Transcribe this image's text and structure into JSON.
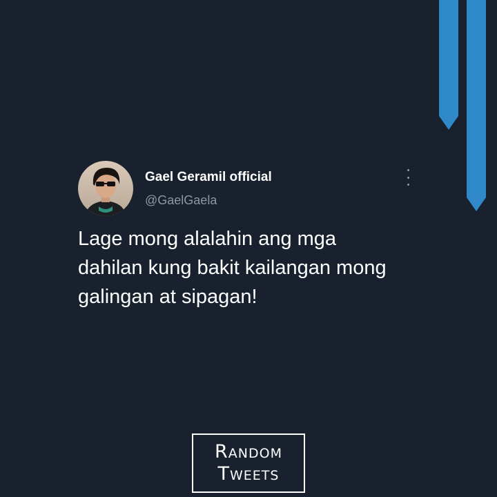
{
  "tweet": {
    "display_name": "Gael Geramil official",
    "handle": "@GaelGaela",
    "text": "Lage mong alalahin ang mga dahilan kung bakit kailangan mong galingan at sipagan!"
  },
  "logo": {
    "line1": "Random",
    "line2": "Tweets"
  },
  "colors": {
    "background": "#18212d",
    "ribbon": "#2f89c9",
    "handle": "#8b98a5"
  },
  "icons": {
    "more": "vertical-ellipsis-icon"
  }
}
